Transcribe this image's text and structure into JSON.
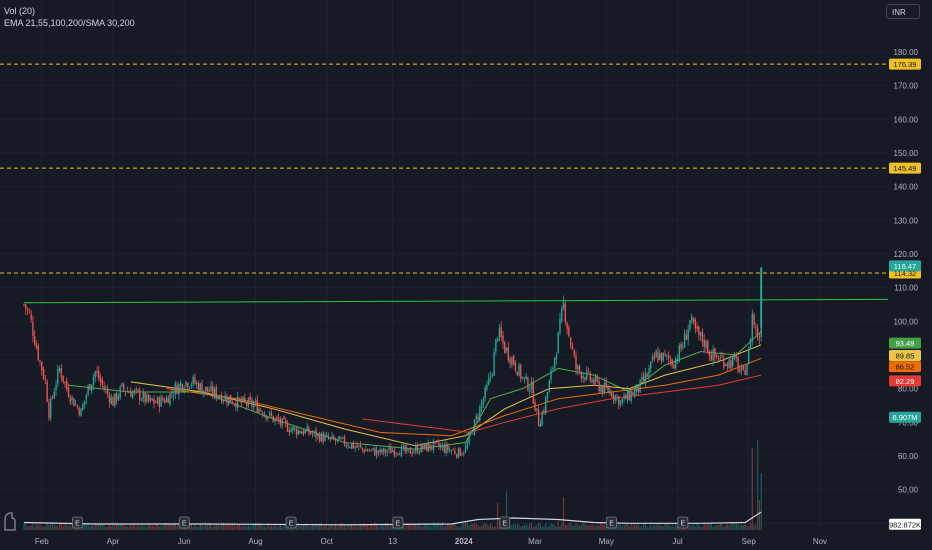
{
  "legend": {
    "line1": "Vol (20)",
    "line2": "EMA 21,55,100,200/SMA 30,200"
  },
  "currency": "INR",
  "colors": {
    "bg": "#161a25",
    "grid": "#1f2330",
    "axis_text": "#b2b5be",
    "up": "#26a69a",
    "down": "#ef5350",
    "trend": "#26c63f",
    "dash": "#f0c020",
    "ema_red": "#e53935",
    "ema_orange": "#ef6c00",
    "ema_yellow": "#e8c547",
    "ema_green": "#4caf50",
    "vol_up": "#26a69a",
    "vol_down": "#ef5350",
    "vol_ma": "#d1d4dc"
  },
  "chart_data": {
    "type": "candlestick",
    "y_axis": {
      "ticks": [
        180,
        170,
        160,
        150,
        140,
        130,
        120,
        110,
        100,
        90,
        80,
        70,
        60,
        50,
        40
      ],
      "ylim": [
        38,
        188
      ],
      "position": "right"
    },
    "x_axis": {
      "labels": [
        "Feb",
        "Apr",
        "Jun",
        "Aug",
        "Oct",
        "13",
        "2024",
        "Mar",
        "May",
        "Jul",
        "Sep",
        "Nov"
      ],
      "label_index": [
        10,
        50,
        90,
        130,
        170,
        207,
        247,
        287,
        327,
        367,
        407,
        447
      ],
      "bold": [
        false,
        false,
        false,
        false,
        false,
        false,
        true,
        false,
        false,
        false,
        false,
        false
      ],
      "n_slots": 465
    },
    "price_points": [
      [
        0,
        105
      ],
      [
        3,
        102
      ],
      [
        8,
        90
      ],
      [
        12,
        82
      ],
      [
        14,
        73
      ],
      [
        17,
        80
      ],
      [
        20,
        86
      ],
      [
        24,
        80
      ],
      [
        28,
        76
      ],
      [
        32,
        73
      ],
      [
        36,
        80
      ],
      [
        40,
        85
      ],
      [
        45,
        80
      ],
      [
        50,
        76
      ],
      [
        55,
        80
      ],
      [
        60,
        79
      ],
      [
        65,
        78
      ],
      [
        70,
        76
      ],
      [
        75,
        76
      ],
      [
        80,
        77
      ],
      [
        85,
        80
      ],
      [
        90,
        82
      ],
      [
        95,
        82
      ],
      [
        100,
        80
      ],
      [
        110,
        78
      ],
      [
        120,
        76
      ],
      [
        130,
        75
      ],
      [
        140,
        71
      ],
      [
        150,
        68
      ],
      [
        160,
        67
      ],
      [
        170,
        65
      ],
      [
        180,
        64
      ],
      [
        190,
        62
      ],
      [
        200,
        61
      ],
      [
        210,
        62
      ],
      [
        215,
        61
      ],
      [
        220,
        62
      ],
      [
        230,
        63
      ],
      [
        238,
        62
      ],
      [
        244,
        61
      ],
      [
        248,
        62
      ],
      [
        252,
        68
      ],
      [
        256,
        74
      ],
      [
        260,
        80
      ],
      [
        263,
        86
      ],
      [
        266,
        97
      ],
      [
        270,
        92
      ],
      [
        275,
        88
      ],
      [
        280,
        83
      ],
      [
        285,
        80
      ],
      [
        289,
        70
      ],
      [
        292,
        74
      ],
      [
        296,
        84
      ],
      [
        300,
        95
      ],
      [
        303,
        105
      ],
      [
        306,
        96
      ],
      [
        310,
        86
      ],
      [
        315,
        84
      ],
      [
        320,
        82
      ],
      [
        325,
        80
      ],
      [
        330,
        79
      ],
      [
        335,
        76
      ],
      [
        340,
        78
      ],
      [
        345,
        80
      ],
      [
        350,
        84
      ],
      [
        355,
        90
      ],
      [
        360,
        89
      ],
      [
        365,
        88
      ],
      [
        370,
        93
      ],
      [
        374,
        100
      ],
      [
        378,
        96
      ],
      [
        382,
        94
      ],
      [
        386,
        90
      ],
      [
        390,
        89
      ],
      [
        395,
        88
      ],
      [
        400,
        88
      ],
      [
        402,
        85
      ],
      [
        404,
        84
      ],
      [
        407,
        90
      ],
      [
        409,
        102
      ],
      [
        411,
        97
      ],
      [
        413,
        95
      ],
      [
        414,
        116
      ]
    ],
    "series": [
      {
        "name": "EMA 21",
        "color": "#4caf50",
        "points": [
          [
            25,
            81
          ],
          [
            60,
            79
          ],
          [
            100,
            79
          ],
          [
            140,
            71
          ],
          [
            180,
            64
          ],
          [
            220,
            62
          ],
          [
            248,
            64
          ],
          [
            262,
            77
          ],
          [
            280,
            80
          ],
          [
            300,
            86
          ],
          [
            320,
            84
          ],
          [
            340,
            79
          ],
          [
            360,
            87
          ],
          [
            380,
            91
          ],
          [
            400,
            90
          ],
          [
            414,
            97
          ]
        ]
      },
      {
        "name": "EMA 55",
        "color": "#e8c547",
        "points": [
          [
            60,
            82
          ],
          [
            100,
            79
          ],
          [
            140,
            74
          ],
          [
            180,
            68
          ],
          [
            220,
            63
          ],
          [
            248,
            66
          ],
          [
            270,
            74
          ],
          [
            295,
            80
          ],
          [
            320,
            81
          ],
          [
            340,
            80
          ],
          [
            360,
            84
          ],
          [
            390,
            88
          ],
          [
            414,
            93
          ]
        ]
      },
      {
        "name": "EMA 100",
        "color": "#ef6c00",
        "points": [
          [
            80,
            80
          ],
          [
            120,
            77
          ],
          [
            160,
            72
          ],
          [
            200,
            67
          ],
          [
            240,
            66
          ],
          [
            270,
            72
          ],
          [
            300,
            77
          ],
          [
            330,
            79
          ],
          [
            360,
            81
          ],
          [
            390,
            84
          ],
          [
            414,
            89
          ]
        ]
      },
      {
        "name": "EMA 200",
        "color": "#e53935",
        "points": [
          [
            190,
            71
          ],
          [
            220,
            69
          ],
          [
            250,
            67
          ],
          [
            270,
            70
          ],
          [
            300,
            74
          ],
          [
            330,
            77
          ],
          [
            360,
            79
          ],
          [
            390,
            81
          ],
          [
            414,
            84
          ]
        ]
      }
    ],
    "trendline": {
      "color": "#26c63f",
      "points": [
        [
          0,
          105.5
        ],
        [
          465,
          106.5
        ]
      ]
    },
    "hlines": [
      {
        "y": 176.39,
        "label": "176.39",
        "bg": "#f0c020",
        "fg": "#131722",
        "dashed": true
      },
      {
        "y": 145.49,
        "label": "145.49",
        "bg": "#f0c020",
        "fg": "#131722",
        "dashed": true
      },
      {
        "y": 114.32,
        "label": "114.32",
        "bg": "#f0c020",
        "fg": "#131722",
        "dashed": true
      }
    ],
    "price_labels": [
      {
        "y": 116.47,
        "label": "116.47",
        "bg": "#26a69a",
        "fg": "#ffffff"
      },
      {
        "y": 93.49,
        "label": "93.49",
        "bg": "#43a047",
        "fg": "#ffffff"
      },
      {
        "y": 89.85,
        "label": "89.85",
        "bg": "#e8c547",
        "fg": "#131722"
      },
      {
        "y": 86.52,
        "label": "86.52",
        "bg": "#ef6c00",
        "fg": "#131722"
      },
      {
        "y": 82.29,
        "label": "82.29",
        "bg": "#e53935",
        "fg": "#ffffff"
      },
      {
        "y": 71.5,
        "label": "6.907M",
        "bg": "#26a69a",
        "fg": "#ffffff"
      },
      {
        "y": 39.7,
        "label": "982.872K",
        "bg": "#ffffff",
        "fg": "#131722"
      }
    ],
    "volume": {
      "avg": "982.872K",
      "spikes": [
        [
          266,
          0.18
        ],
        [
          271,
          0.26
        ],
        [
          300,
          0.06
        ],
        [
          303,
          0.22
        ],
        [
          325,
          0.04
        ],
        [
          409,
          0.55
        ],
        [
          412,
          0.6
        ],
        [
          414,
          0.38
        ],
        [
          413,
          0.2
        ]
      ]
    },
    "earnings_markers": [
      30,
      90,
      150,
      210,
      270,
      330,
      370
    ]
  }
}
